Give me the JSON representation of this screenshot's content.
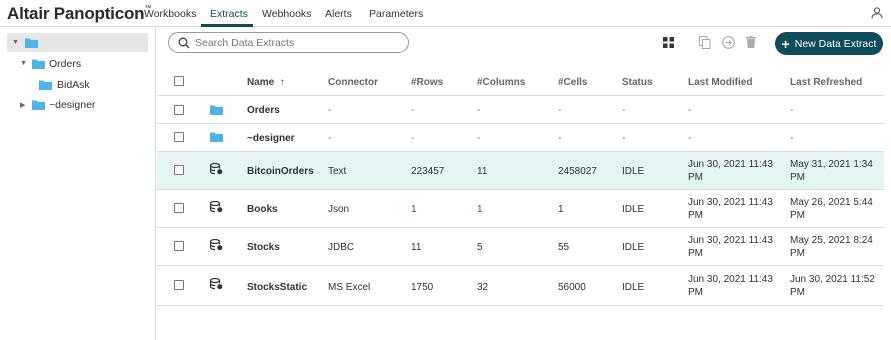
{
  "app": {
    "brand": "Altair Panopticon",
    "trademark": "™"
  },
  "nav": {
    "tabs": [
      {
        "label": "Workbooks"
      },
      {
        "label": "Extracts"
      },
      {
        "label": "Webhooks"
      },
      {
        "label": "Alerts"
      },
      {
        "label": "Parameters"
      }
    ],
    "active_tab": "Extracts"
  },
  "sidebar": {
    "tree": [
      {
        "label": "",
        "level": 0,
        "expanded": true
      },
      {
        "label": "Orders",
        "level": 1,
        "expanded": true
      },
      {
        "label": "BidAsk",
        "level": 2
      },
      {
        "label": "~designer",
        "level": 1,
        "expanded": false
      }
    ]
  },
  "toolbar": {
    "search_placeholder": "Search Data Extracts",
    "new_button_label": "New Data Extract",
    "icons": [
      "grid-view-icon",
      "copy-icon",
      "move-icon",
      "delete-icon"
    ]
  },
  "table": {
    "columns": [
      "Name",
      "Connector",
      "#Rows",
      "#Columns",
      "#Cells",
      "Status",
      "Last Modified",
      "Last Refreshed"
    ],
    "sort_indicator": "↑",
    "rows": [
      {
        "type": "folder",
        "name": "Orders",
        "connector": "-",
        "rows": "-",
        "columns": "-",
        "cells": "-",
        "status": "-",
        "modified": "-",
        "refreshed": "-"
      },
      {
        "type": "folder",
        "name": "~designer",
        "connector": "-",
        "rows": "-",
        "columns": "-",
        "cells": "-",
        "status": "-",
        "modified": "-",
        "refreshed": "-"
      },
      {
        "type": "extract",
        "name": "BitcoinOrders",
        "connector": "Text",
        "rows": "223457",
        "columns": "11",
        "cells": "2458027",
        "status": "IDLE",
        "modified": "Jun 30, 2021 11:43 PM",
        "refreshed": "May 31, 2021 1:34 PM",
        "selected": true
      },
      {
        "type": "extract",
        "name": "Books",
        "connector": "Json",
        "rows": "1",
        "columns": "1",
        "cells": "1",
        "status": "IDLE",
        "modified": "Jun 30, 2021 11:43 PM",
        "refreshed": "May 26, 2021 5:44 PM"
      },
      {
        "type": "extract",
        "name": "Stocks",
        "connector": "JDBC",
        "rows": "11",
        "columns": "5",
        "cells": "55",
        "status": "IDLE",
        "modified": "Jun 30, 2021 11:43 PM",
        "refreshed": "May 25, 2021 8:24 PM"
      },
      {
        "type": "extract",
        "name": "StocksStatic",
        "connector": "MS Excel",
        "rows": "1750",
        "columns": "32",
        "cells": "56000",
        "status": "IDLE",
        "modified": "Jun 30, 2021 11:43 PM",
        "refreshed": "Jun 30, 2021 11:52 PM"
      }
    ]
  },
  "colors": {
    "accent": "#0f4c5c",
    "folder": "#4fb3e8",
    "selected_row": "#e6f4f4"
  }
}
